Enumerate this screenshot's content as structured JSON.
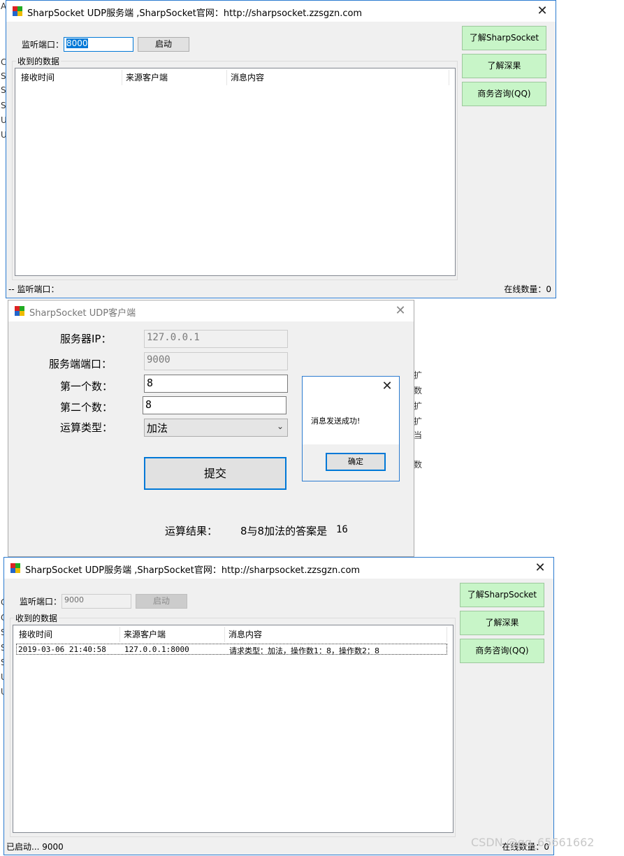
{
  "server_window_1": {
    "title": "SharpSocket UDP服务端 ,SharpSocket官网：http://sharpsocket.zzsgzn.com",
    "port_label": "监听端口：",
    "port_value": "8000",
    "start_button": "启动",
    "side_buttons": [
      "了解SharpSocket",
      "了解深果",
      "商务咨询(QQ)"
    ],
    "group_title": "收到的数据",
    "columns": [
      "接收时间",
      "来源客户端",
      "消息内容"
    ],
    "status_left": "--  监听端口：",
    "status_right": "在线数量：0"
  },
  "client_window": {
    "title": "SharpSocket UDP客户端",
    "server_ip_label": "服务器IP：",
    "server_ip_value": "127.0.0.1",
    "server_port_label": "服务端端口：",
    "server_port_value": "9000",
    "first_num_label": "第一个数：",
    "first_num_value": "8",
    "second_num_label": "第二个数：",
    "second_num_value": "8",
    "op_label": "运算类型：",
    "op_value": "加法",
    "submit_button": "提交",
    "result_label": "运算结果：",
    "result_text": "8与8加法的答案是",
    "result_value": "16"
  },
  "message_box": {
    "message": "消息发送成功!",
    "ok_button": "确定"
  },
  "server_window_2": {
    "title": "SharpSocket UDP服务端 ,SharpSocket官网：http://sharpsocket.zzsgzn.com",
    "port_label": "监听端口：",
    "port_value": "9000",
    "start_button": "启动",
    "side_buttons": [
      "了解SharpSocket",
      "了解深果",
      "商务咨询(QQ)"
    ],
    "group_title": "收到的数据",
    "columns": [
      "接收时间",
      "来源客户端",
      "消息内容"
    ],
    "rows": [
      {
        "time": "2019-03-06 21:40:58",
        "client": "127.0.0.1:8000",
        "message": "请求类型：加法，操作数1：8，操作数2：8"
      }
    ],
    "status_left": "已启动...  9000",
    "status_right": "在线数量：0"
  },
  "watermark": "CSDN @qq_65661662",
  "colors": {
    "accent": "#0078d7",
    "green_button": "#c8f5c8",
    "window_bg": "#f0f0f0"
  }
}
